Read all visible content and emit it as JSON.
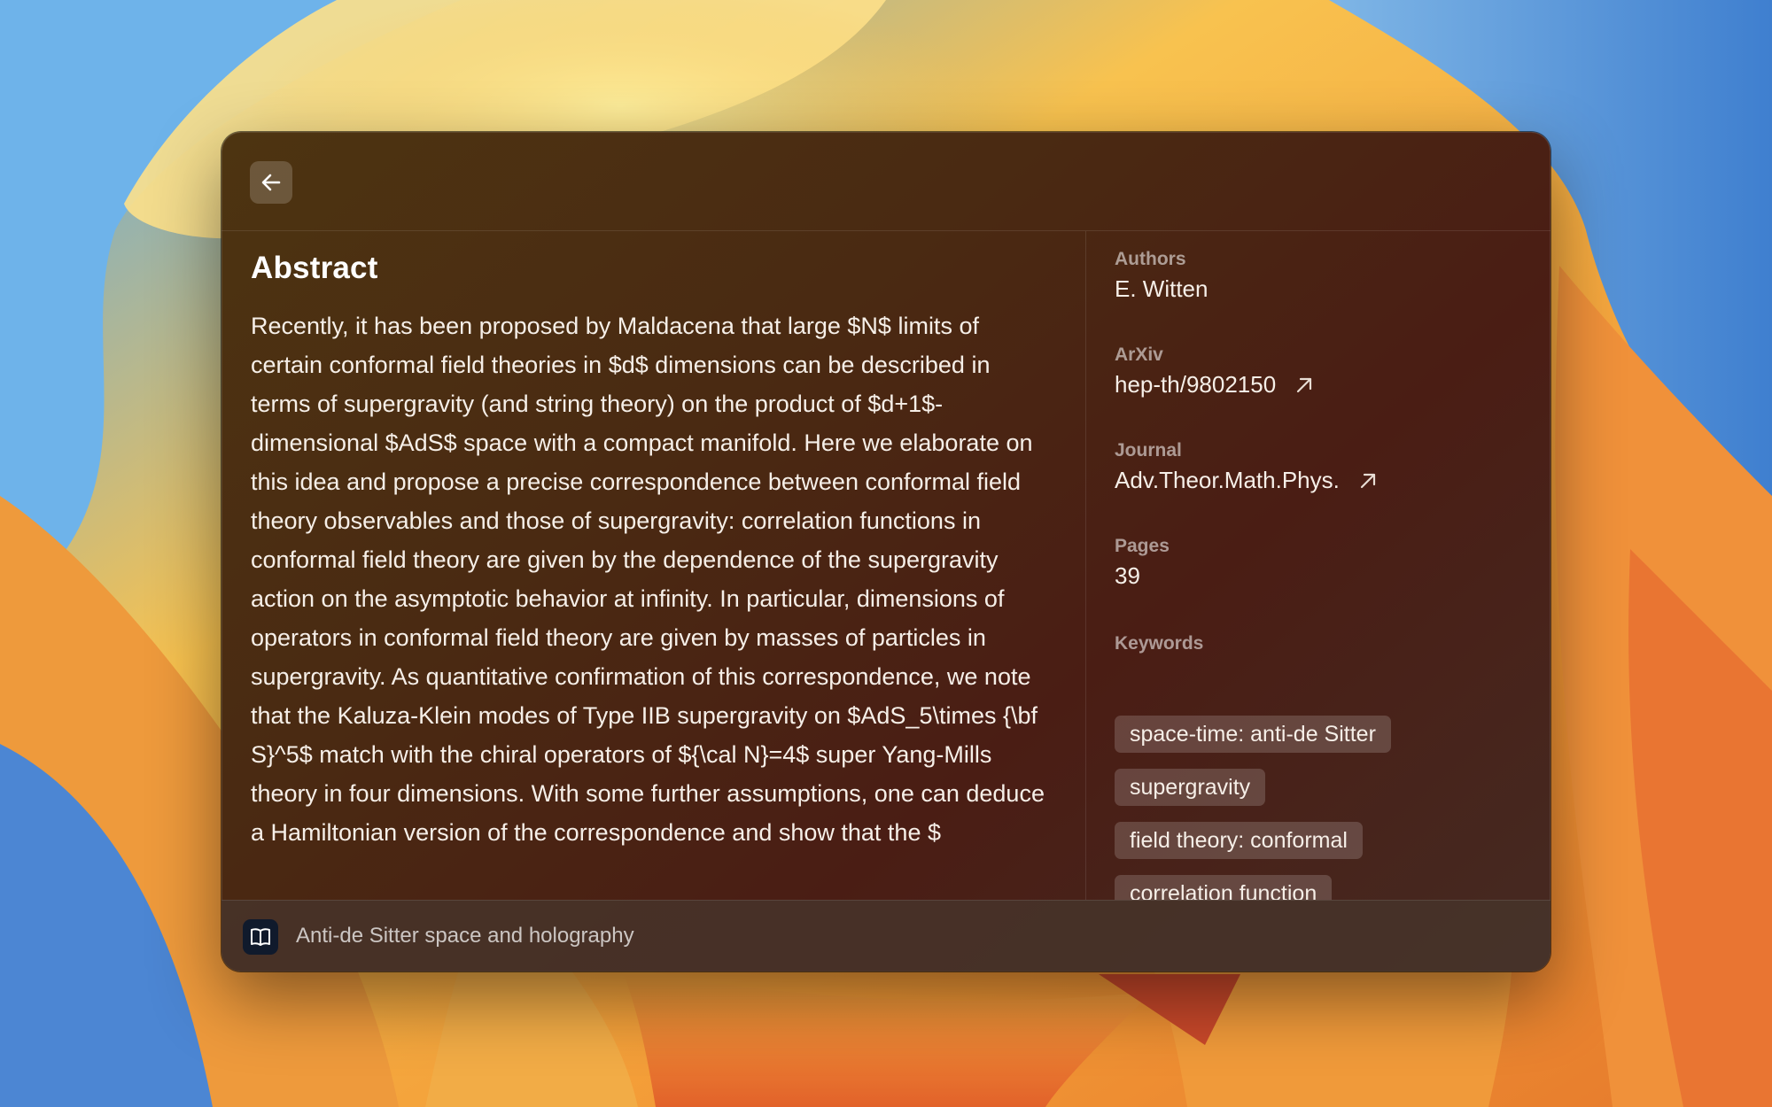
{
  "window": {
    "back_icon": "arrow-left-icon"
  },
  "abstract": {
    "heading": "Abstract",
    "text": "Recently, it has been proposed by Maldacena that large $N$ limits of certain conformal field theories in $d$ dimensions can be described in terms of supergravity (and string theory) on the product of $d+1$-dimensional $AdS$ space with a compact manifold. Here we elaborate on this idea and propose a precise correspondence between conformal field theory observables and those of supergravity: correlation functions in conformal field theory are given by the dependence of the supergravity action on the asymptotic behavior at infinity. In particular, dimensions of operators in conformal field theory are given by masses of particles in supergravity. As quantitative confirmation of this correspondence, we note that the Kaluza-Klein modes of Type IIB supergravity on $AdS_5\\times {\\bf S}^5$ match with the chiral operators of ${\\cal N}=4$ super Yang-Mills theory in four dimensions. With some further assumptions, one can deduce a Hamiltonian version of the correspondence and show that the $"
  },
  "metadata": {
    "authors_label": "Authors",
    "authors_value": "E. Witten",
    "arxiv_label": "ArXiv",
    "arxiv_value": "hep-th/9802150",
    "journal_label": "Journal",
    "journal_value": "Adv.Theor.Math.Phys.",
    "pages_label": "Pages",
    "pages_value": "39",
    "keywords_label": "Keywords",
    "keywords": [
      "space-time: anti-de Sitter",
      "supergravity",
      "field theory: conformal",
      "correlation function",
      "",
      ""
    ],
    "link_icon": "external-link-arrow-icon"
  },
  "footer": {
    "icon": "book-open-icon",
    "title": "Anti-de Sitter space and holography"
  },
  "colors": {
    "window_tint": "#4a2a12",
    "tag_background": "#6a5248",
    "footer_icon_bg": "#101a2c"
  }
}
